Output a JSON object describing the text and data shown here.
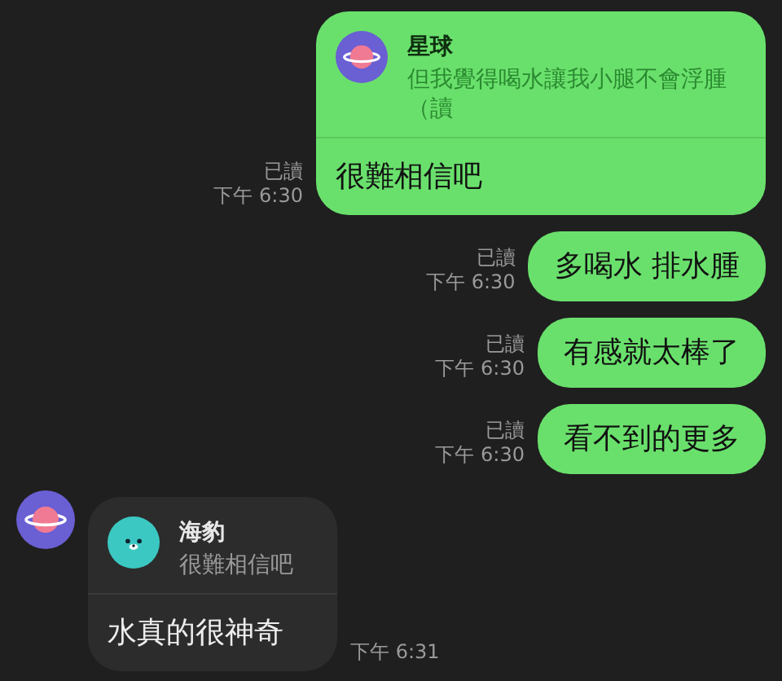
{
  "messages": [
    {
      "kind": "outgoing",
      "read": "已讀",
      "time": "下午 6:30",
      "reply": {
        "avatar": {
          "kind": "planet"
        },
        "name": "星球",
        "text": "但我覺得喝水讓我小腿不會浮腫（讀"
      },
      "text": "很難相信吧"
    },
    {
      "kind": "outgoing",
      "read": "已讀",
      "time": "下午 6:30",
      "text": "多喝水 排水腫"
    },
    {
      "kind": "outgoing",
      "read": "已讀",
      "time": "下午 6:30",
      "text": "有感就太棒了"
    },
    {
      "kind": "outgoing",
      "read": "已讀",
      "time": "下午 6:30",
      "text": "看不到的更多"
    },
    {
      "kind": "incoming",
      "avatar": {
        "kind": "planet"
      },
      "time": "下午 6:31",
      "reply": {
        "avatar": {
          "kind": "seal"
        },
        "name": "海豹",
        "text": "很難相信吧"
      },
      "text": "水真的很神奇"
    }
  ]
}
